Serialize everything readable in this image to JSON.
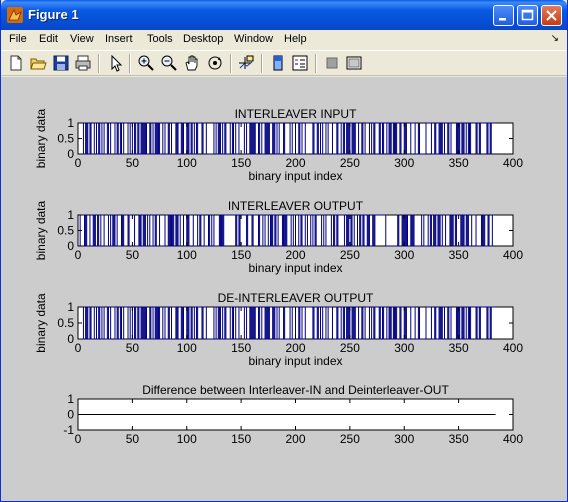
{
  "window": {
    "title": "Figure 1"
  },
  "menu": [
    "File",
    "Edit",
    "View",
    "Insert",
    "Tools",
    "Desktop",
    "Window",
    "Help"
  ],
  "menu_arrow": "↘",
  "toolbar": [
    "new-file-icon",
    "open-folder-icon",
    "save-icon",
    "print-icon",
    "pointer-icon",
    "zoom-in-icon",
    "zoom-out-icon",
    "pan-hand-icon",
    "rotate-3d-icon",
    "data-cursor-icon",
    "colorbar-icon",
    "legend-icon",
    "hide-plot-tools-icon",
    "show-plot-tools-icon"
  ],
  "chart_data": [
    {
      "type": "line",
      "title": "INTERLEAVER INPUT",
      "xlabel": "binary input index",
      "ylabel": "binary data",
      "xlim": [
        0,
        400
      ],
      "ylim": [
        0,
        1
      ],
      "xticks": [
        "0",
        "50",
        "100",
        "150",
        "200",
        "250",
        "300",
        "350",
        "400"
      ],
      "yticks": [
        "0",
        "0.5",
        "1"
      ],
      "n_points": 384,
      "seed": 11,
      "color": "#000080"
    },
    {
      "type": "line",
      "title": "INTERLEAVER OUTPUT",
      "xlabel": "binary input index",
      "ylabel": "binary data",
      "xlim": [
        0,
        400
      ],
      "ylim": [
        0,
        1
      ],
      "xticks": [
        "0",
        "50",
        "100",
        "150",
        "200",
        "250",
        "300",
        "350",
        "400"
      ],
      "yticks": [
        "0",
        "0.5",
        "1"
      ],
      "n_points": 384,
      "seed": 29,
      "color": "#000080"
    },
    {
      "type": "line",
      "title": "DE-INTERLEAVER OUTPUT",
      "xlabel": "binary input index",
      "ylabel": "binary data",
      "xlim": [
        0,
        400
      ],
      "ylim": [
        0,
        1
      ],
      "xticks": [
        "0",
        "50",
        "100",
        "150",
        "200",
        "250",
        "300",
        "350",
        "400"
      ],
      "yticks": [
        "0",
        "0.5",
        "1"
      ],
      "n_points": 384,
      "seed": 11,
      "color": "#000080"
    },
    {
      "type": "line",
      "title": "Difference between Interleaver-IN and Deinterleaver-OUT",
      "xlabel": "",
      "ylabel": "",
      "xlim": [
        0,
        400
      ],
      "ylim": [
        -1,
        1
      ],
      "xticks": [
        "0",
        "50",
        "100",
        "150",
        "200",
        "250",
        "300",
        "350",
        "400"
      ],
      "yticks": [
        "-1",
        "0",
        "1"
      ],
      "x": [
        1,
        384
      ],
      "y": [
        0,
        0
      ],
      "color": "#000000"
    }
  ]
}
